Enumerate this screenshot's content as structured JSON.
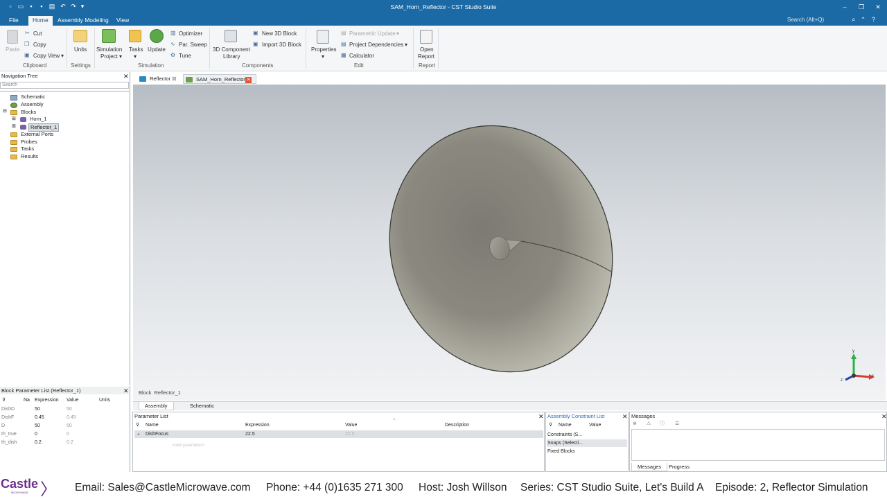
{
  "window": {
    "title": "SAM_Horn_Reflector - CST Studio Suite",
    "search_placeholder": "Search (Alt+Q)"
  },
  "menu": {
    "file": "File",
    "tabs": [
      "Home",
      "Assembly Modeling",
      "View"
    ]
  },
  "ribbon": {
    "clipboard": {
      "paste": "Paste",
      "cut": "Cut",
      "copy": "Copy",
      "copy_view": "Copy View",
      "label": "Clipboard"
    },
    "settings": {
      "units": "Units",
      "label": "Settings"
    },
    "simulation": {
      "sim_project_1": "Simulation",
      "sim_project_2": "Project",
      "tasks": "Tasks",
      "update": "Update",
      "optimizer": "Optimizer",
      "par_sweep": "Par. Sweep",
      "tune": "Tune",
      "label": "Simulation"
    },
    "components": {
      "lib_1": "3D Component",
      "lib_2": "Library",
      "new_block": "New 3D Block",
      "import_block": "Import 3D Block",
      "label": "Components"
    },
    "edit": {
      "properties": "Properties",
      "parametric_update": "Parametric Update",
      "project_dependencies": "Project Dependencies",
      "calculator": "Calculator",
      "label": "Edit"
    },
    "report": {
      "open_1": "Open",
      "open_2": "Report",
      "label": "Report"
    }
  },
  "nav_tree": {
    "title": "Navigation Tree",
    "search_placeholder": "Search",
    "items": [
      "Schematic",
      "Assembly",
      "Blocks",
      "Horn_1",
      "Reflector_1",
      "External Ports",
      "Probes",
      "Tasks",
      "Results"
    ]
  },
  "block_params": {
    "title": "Block Parameter List (Reflector_1)",
    "columns": [
      "Na",
      "Expression",
      "Value",
      "Units"
    ],
    "rows": [
      {
        "name": "DishD",
        "expr": "50",
        "value": "50"
      },
      {
        "name": "DishF",
        "expr": "0.45",
        "value": "0.45"
      },
      {
        "name": "D",
        "expr": "50",
        "value": "50"
      },
      {
        "name": "th_true",
        "expr": "0",
        "value": "0"
      },
      {
        "name": "th_dish",
        "expr": "0.2",
        "value": "0.2"
      }
    ]
  },
  "doc_tabs": [
    "Reflector",
    "SAM_Horn_Reflector"
  ],
  "viewport": {
    "status_prefix": "Block",
    "status_value": "Reflector_1",
    "axis_x": "x",
    "axis_y": "y",
    "axis_z": "z"
  },
  "view_tabs": [
    "Assembly",
    "Schematic"
  ],
  "param_list": {
    "title": "Parameter List",
    "columns": [
      "Name",
      "Expression",
      "Value",
      "Description"
    ],
    "rows": [
      {
        "name": "DishFocus",
        "expr": "22.5",
        "value": "22.5"
      }
    ],
    "new_param": "<new parameter>"
  },
  "constraints": {
    "title": "Assembly Constraint List",
    "columns": [
      "Name",
      "Value"
    ],
    "rows": [
      "Constraints (S...",
      "Snaps (Selecti...",
      "Fixed Blocks"
    ]
  },
  "messages": {
    "title": "Messages",
    "tabs": [
      "Messages",
      "Progress"
    ]
  },
  "footer": {
    "logo": "Castle",
    "logo_sub": "MICROWAVE",
    "email": "Email: Sales@CastleMicrowave.com",
    "phone": "Phone: +44 (0)1635 271 300",
    "host": "Host: Josh Willson",
    "series": "Series: CST Studio Suite, Let's Build A",
    "episode": "Episode: 2, Reflector Simulation"
  },
  "colors": {
    "titlebar": "#1b6aa5",
    "brand": "#6a2e8c"
  }
}
